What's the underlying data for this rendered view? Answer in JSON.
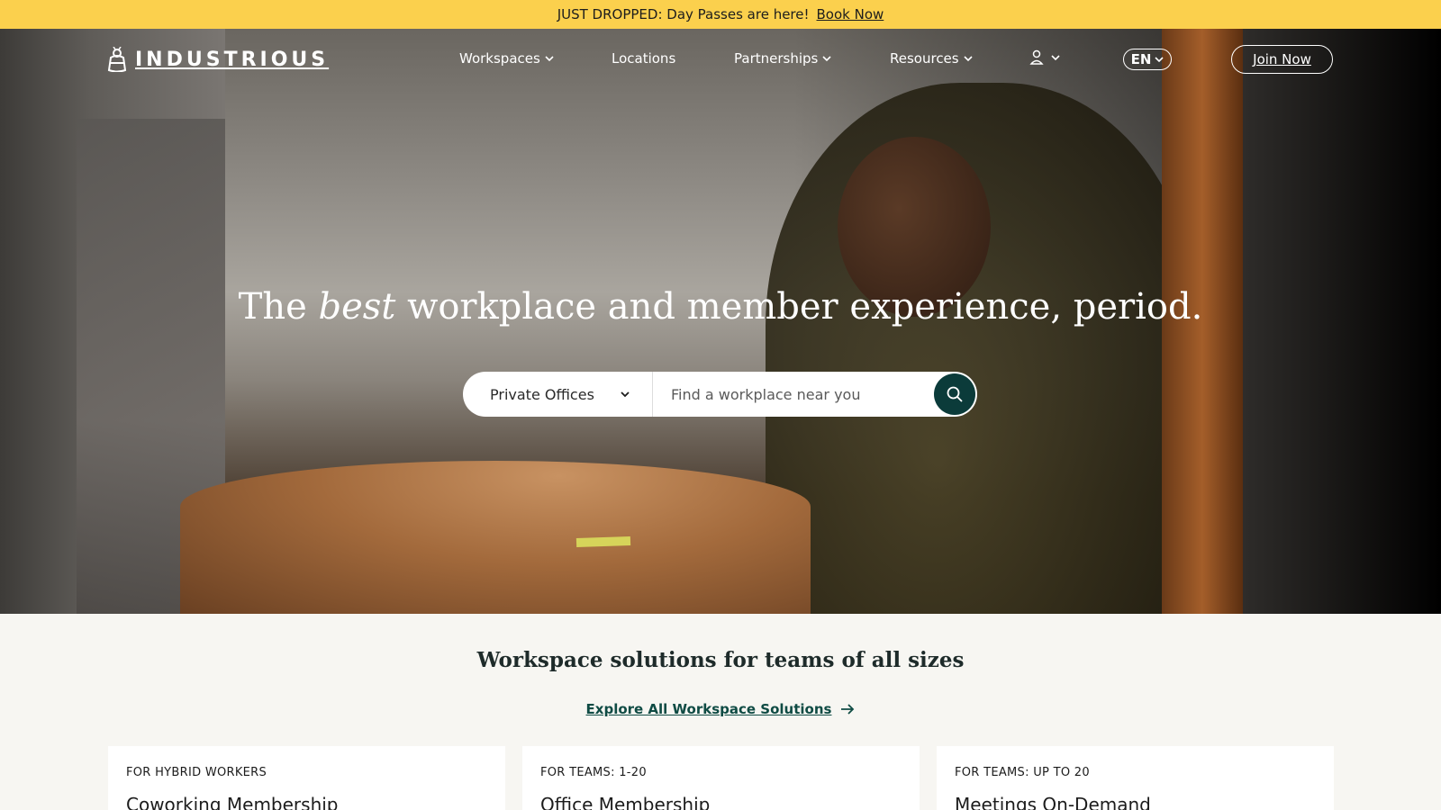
{
  "announcement": {
    "text": "JUST DROPPED: Day Passes are here!",
    "link": "Book Now"
  },
  "nav": {
    "logo": "INDUSTRIOUS",
    "items": [
      {
        "label": "Workspaces",
        "has_dropdown": true
      },
      {
        "label": "Locations",
        "has_dropdown": false
      },
      {
        "label": "Partnerships",
        "has_dropdown": true
      },
      {
        "label": "Resources",
        "has_dropdown": true
      }
    ],
    "language": "EN",
    "join": "Join Now"
  },
  "hero": {
    "headline_pre": "The",
    "headline_em": "best",
    "headline_post": "workplace and member experience, period.",
    "search": {
      "select_value": "Private Offices",
      "placeholder": "Find a workplace near you"
    }
  },
  "solutions": {
    "title": "Workspace solutions for teams of all sizes",
    "explore_link": "Explore All Workspace Solutions",
    "cards": [
      {
        "tag": "FOR HYBRID WORKERS",
        "title": "Coworking Membership"
      },
      {
        "tag": "FOR TEAMS: 1-20",
        "title": "Office Membership"
      },
      {
        "tag": "FOR TEAMS: UP TO 20",
        "title": "Meetings On-Demand"
      }
    ]
  },
  "colors": {
    "announcement_bg": "#fbd04d",
    "search_button": "#0b3b3a",
    "link": "#0f4b44",
    "section_bg": "#f7f6f2"
  }
}
